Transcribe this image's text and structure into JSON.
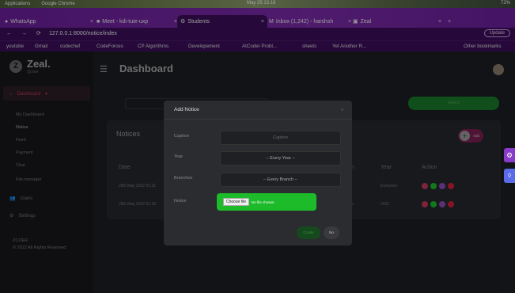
{
  "os": {
    "apps": "Applications",
    "chrome": "Google Chrome",
    "clock": "May 25 13:16",
    "status": "72%"
  },
  "tabs": [
    {
      "label": "WhatsApp"
    },
    {
      "label": "Meet - kdi-tuie-uxp"
    },
    {
      "label": "Students"
    },
    {
      "label": "Inbox (1,242) - harshsh"
    },
    {
      "label": "Zeal"
    }
  ],
  "address": {
    "url": "127.0.0.1:8000/notice/index",
    "update": "Update"
  },
  "bookmarks": [
    "youtube",
    "Gmail",
    "codechef",
    "CodeForces",
    "CP Algorithms",
    "Developement",
    "AtCoder Probl...",
    "sheets",
    "Yet Another R...",
    "Other bookmarks"
  ],
  "sidebar": {
    "brand": "Zeal.",
    "brand_sub": "@zoer",
    "dashboard": "Dashboard",
    "subitems": [
      "My Dashboard",
      "Notice",
      "Feed",
      "Payment",
      "Chat",
      "File-manager"
    ],
    "users": "Users",
    "settings": "Settings",
    "footer1": "ZCOER",
    "footer2": "© 2022 All Rights Reserved"
  },
  "header": {
    "title": "Dashboard"
  },
  "filter": {
    "branch": "-- Your Branch --",
    "search": "Search"
  },
  "notices": {
    "title": "Notices",
    "add": "Add",
    "columns": [
      "Date",
      "ch",
      "Year",
      "Action"
    ],
    "rows": [
      {
        "date": "25th May 2022 01:31",
        "branch": "ne",
        "year": "Everyone"
      },
      {
        "date": "25th May 2022 01:33",
        "branch": "ner",
        "year": "2021"
      }
    ]
  },
  "modal": {
    "title": "Add Notice",
    "close": "×",
    "caption_label": "Caption",
    "caption_placeholder": "Caption",
    "year_label": "Year",
    "year_value": "-- Every Year --",
    "branches_label": "Branches",
    "branches_value": "-- Every Branch --",
    "notice_label": "Notice",
    "choose_file": "Choose file",
    "no_file": "No file chosen",
    "create": "Create",
    "no": "No"
  },
  "colors": {
    "accent": "#c0385a",
    "primary": "#1dbb2a",
    "chrome": "#3b0f5a"
  }
}
